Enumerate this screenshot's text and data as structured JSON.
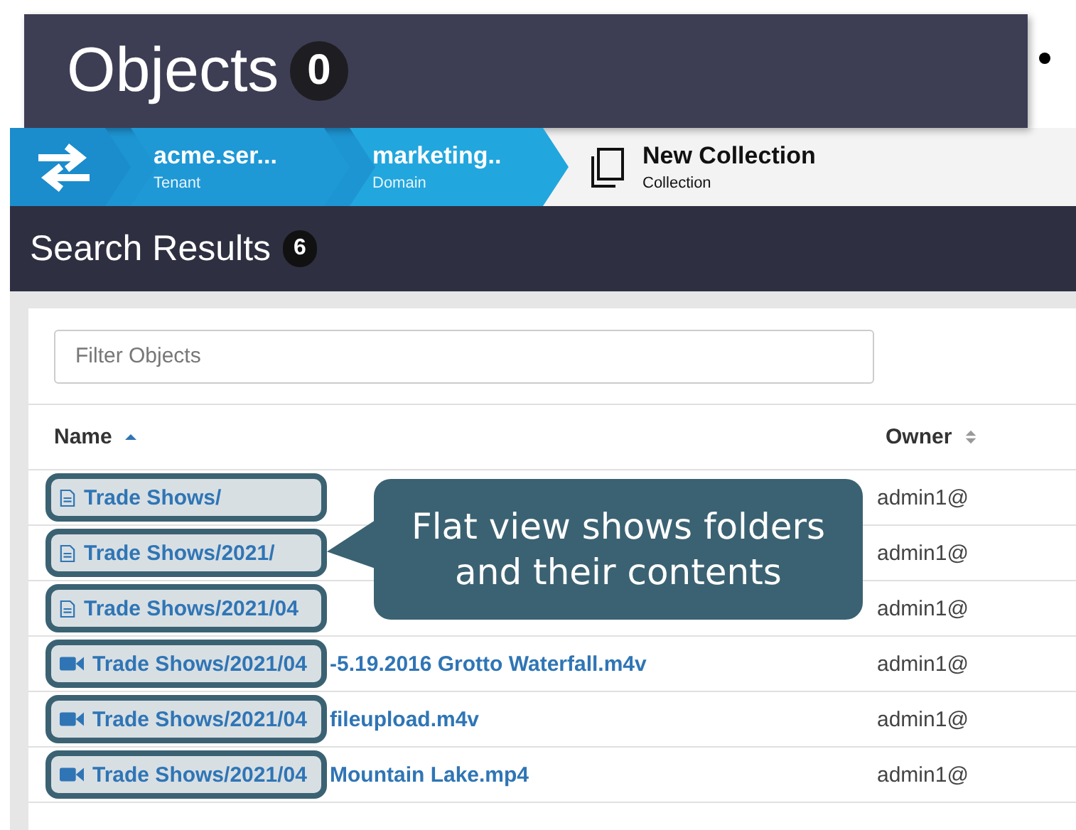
{
  "slide": {
    "title": "Objects",
    "count": "0"
  },
  "breadcrumb": [
    {
      "title": "acme.ser...",
      "subtitle": "Tenant"
    },
    {
      "title": "marketing..",
      "subtitle": "Domain"
    }
  ],
  "collection": {
    "title": "New Collection",
    "subtitle": "Collection"
  },
  "header": {
    "title": "Search Results",
    "count": "6"
  },
  "filter": {
    "placeholder": "Filter Objects"
  },
  "columns": [
    {
      "label": "Name",
      "sorted": true
    },
    {
      "label": "Owner",
      "sorted": false
    }
  ],
  "rows": [
    {
      "kind": "folder",
      "highlighted": "Trade Shows/",
      "owner": "admin1@"
    },
    {
      "kind": "folder",
      "highlighted": "Trade Shows/2021/",
      "owner": "admin1@"
    },
    {
      "kind": "folder",
      "highlighted": "Trade Shows/2021/04",
      "owner": "admin1@"
    },
    {
      "kind": "video",
      "highlighted": "Trade Shows/2021/04",
      "rest": "-5.19.2016 Grotto Waterfall.m4v",
      "owner": "admin1@"
    },
    {
      "kind": "video",
      "highlighted": "Trade Shows/2021/04",
      "rest": "fileupload.m4v",
      "owner": "admin1@"
    },
    {
      "kind": "video",
      "highlighted": "Trade Shows/2021/04",
      "rest": "Mountain Lake.mp4",
      "owner": "admin1@"
    }
  ],
  "callout": {
    "text": "Flat view shows folders and their contents"
  }
}
